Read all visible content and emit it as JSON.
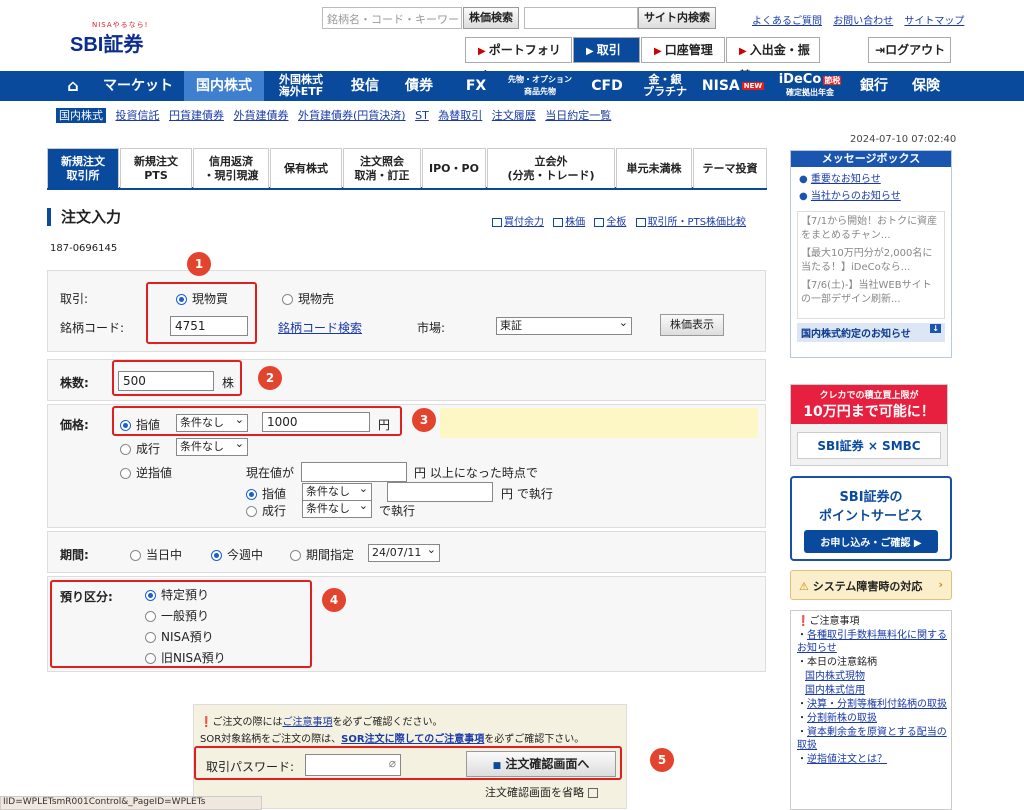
{
  "header": {
    "logo_tagline": "NISAやるなら!",
    "logo_text": "SBI証券",
    "search_placeholder": "銘柄名・コード・キーワード",
    "stock_search_btn": "株価検索",
    "site_search_btn": "サイト内検索",
    "links": [
      "よくあるご質問",
      "お問い合わせ",
      "サイトマップ"
    ],
    "quick_buttons": [
      "ポートフォリオ",
      "取引",
      "口座管理",
      "入出金・振替"
    ],
    "logout": "ログアウト"
  },
  "nav": {
    "home_icon": "home-icon",
    "items": [
      {
        "label": "マーケット"
      },
      {
        "label": "国内株式"
      },
      {
        "label": "外国株式",
        "sub": "海外ETF"
      },
      {
        "label": "投信"
      },
      {
        "label": "債券"
      },
      {
        "label": "FX"
      },
      {
        "label": "先物・オプション",
        "sub": "商品先物"
      },
      {
        "label": "CFD"
      },
      {
        "label": "金・銀",
        "sub": "プラチナ"
      },
      {
        "label": "NISA",
        "badge": "NEW"
      },
      {
        "label": "iDeCo",
        "badge": "節税",
        "sub": "確定拠出年金"
      },
      {
        "label": "銀行"
      },
      {
        "label": "保険"
      }
    ]
  },
  "subnav": [
    "国内株式",
    "投資信託",
    "円貨建債券",
    "外貨建債券",
    "外貨建債券(円貨決済)",
    "ST",
    "為替取引",
    "注文履歴",
    "当日約定一覧"
  ],
  "timestamp": "2024-07-10 07:02:40",
  "tabs": [
    {
      "l1": "新規注文",
      "l2": "取引所"
    },
    {
      "l1": "新規注文",
      "l2": "PTS"
    },
    {
      "l1": "信用返済",
      "l2": "・現引現渡"
    },
    {
      "l1": "保有株式",
      "l2": ""
    },
    {
      "l1": "注文照会",
      "l2": "取消・訂正"
    },
    {
      "l1": "IPO・PO",
      "l2": ""
    },
    {
      "l1": "立会外",
      "l2": "(分売・トレード)"
    },
    {
      "l1": "単元未満株",
      "l2": ""
    },
    {
      "l1": "テーマ投資",
      "l2": ""
    }
  ],
  "order": {
    "title": "注文入力",
    "right_links": [
      "買付余力",
      "株価",
      "全板",
      "取引所・PTS株価比較"
    ],
    "account_no": "187-0696145",
    "trade_label": "取引:",
    "trade_buy": "現物買",
    "trade_sell": "現物売",
    "code_label": "銘柄コード:",
    "code_value": "4751",
    "code_search": "銘柄コード検索",
    "market_label": "市場:",
    "market_value": "東証",
    "price_show_btn": "株価表示",
    "qty_label": "株数:",
    "qty_value": "500",
    "qty_unit": "株",
    "price_label": "価格:",
    "limit": "指値",
    "cond_none": "条件なし",
    "price_value": "1000",
    "yen": "円",
    "market_order": "成行",
    "stop_order": "逆指値",
    "stop_text1": "現在値が",
    "stop_text2": "円 以上になった時点で",
    "stop_limit": "指値",
    "stop_exec": "円 で執行",
    "stop_market": "成行",
    "stop_exec2": "で執行",
    "period_label": "期間:",
    "period_today": "当日中",
    "period_week": "今週中",
    "period_specify": "期間指定",
    "period_date": "24/07/11",
    "custody_label": "預り区分:",
    "custody_options": [
      "特定預り",
      "一般預り",
      "NISA預り",
      "旧NISA預り"
    ],
    "note1_pre": "ご注文の際には",
    "note1_link": "ご注意事項",
    "note1_post": "を必ずご確認ください。",
    "note2_pre": "SOR対象銘柄をご注文の際は、",
    "note2_link": "SOR注文に際してのご注意事項",
    "note2_post": "を必ずご確認下さい。",
    "password_label": "取引パスワード:",
    "confirm_btn": "注文確認画面へ",
    "skip_confirm": "注文確認画面を省略"
  },
  "callouts": [
    "1",
    "2",
    "3",
    "4",
    "5"
  ],
  "sidebar": {
    "msg_title": "メッセージボックス",
    "msg_links": [
      "重要なお知らせ",
      "当社からのお知らせ"
    ],
    "msg_items": [
      "【7/1から開始！おトクに資産をまとめるチャン...",
      "【最大10万円分が2,000名に当たる！】iDeCoなら...",
      "【7/6(土)-】当社WEBサイトの一部デザイン刷新..."
    ],
    "msg_footer": "国内株式約定のお知らせ",
    "banner1_line1": "クレカでの積立買上限が",
    "banner1_line2": "10万円まで可能に！",
    "banner1_brand": "SBI証券 × SMBC",
    "banner2_line1": "SBI証券の",
    "banner2_line2": "ポイントサービス",
    "banner2_btn": "お申し込み・ご確認",
    "system_btn": "システム障害時の対応",
    "notes_title": "ご注意事項",
    "notes": [
      "各種取引手数料無料化に関するお知らせ",
      "本日の注意銘柄",
      "国内株式現物",
      "国内株式信用",
      "決算・分割等権利付銘柄の取扱",
      "分割新株の取扱",
      "資本剰余金を原資とする配当の取扱",
      "逆指値注文とは？"
    ]
  },
  "statusbar": "IID=WPLETsmR001Control&_PageID=WPLETs"
}
